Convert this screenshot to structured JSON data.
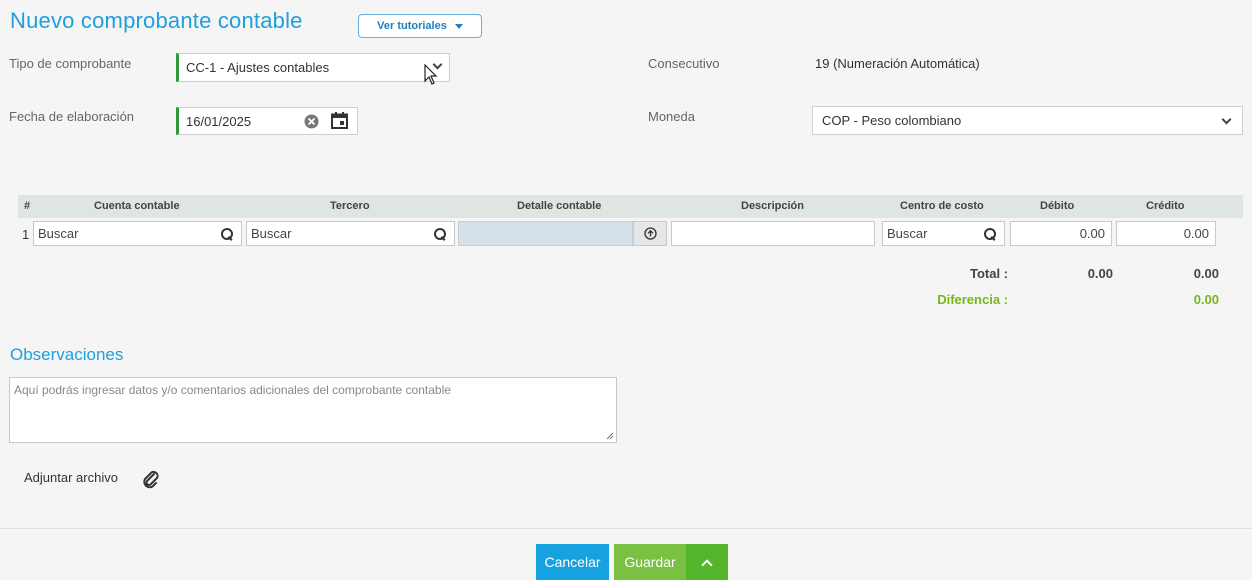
{
  "header": {
    "title": "Nuevo comprobante contable",
    "tutorials_label": "Ver tutoriales"
  },
  "form": {
    "tipo_label": "Tipo de comprobante",
    "tipo_value": "CC-1 - Ajustes contables",
    "consecutivo_label": "Consecutivo",
    "consecutivo_value": "19 (Numeración Automática)",
    "fecha_label": "Fecha de elaboración",
    "fecha_value": "16/01/2025",
    "moneda_label": "Moneda",
    "moneda_value": "COP - Peso colombiano"
  },
  "grid": {
    "columns": [
      "#",
      "Cuenta contable",
      "Tercero",
      "Detalle contable",
      "Descripción",
      "Centro de costo",
      "Débito",
      "Crédito"
    ],
    "row": {
      "index": "1",
      "cuenta_placeholder": "Buscar",
      "tercero_placeholder": "Buscar",
      "detalle": "",
      "descripcion": "",
      "centro_placeholder": "Buscar",
      "debito": "0.00",
      "credito": "0.00"
    },
    "total_label": "Total :",
    "total_debito": "0.00",
    "total_credito": "0.00",
    "diferencia_label": "Diferencia :",
    "diferencia_value": "0.00"
  },
  "observaciones": {
    "title": "Observaciones",
    "placeholder": "Aquí podrás ingresar datos y/o comentarios adicionales del comprobante contable"
  },
  "attach": {
    "label": "Adjuntar archivo"
  },
  "footer": {
    "cancel_label": "Cancelar",
    "save_label": "Guardar"
  },
  "colors": {
    "accent_blue": "#1f9ee0",
    "green": "#7ab51d",
    "save_green": "#7ac142"
  }
}
